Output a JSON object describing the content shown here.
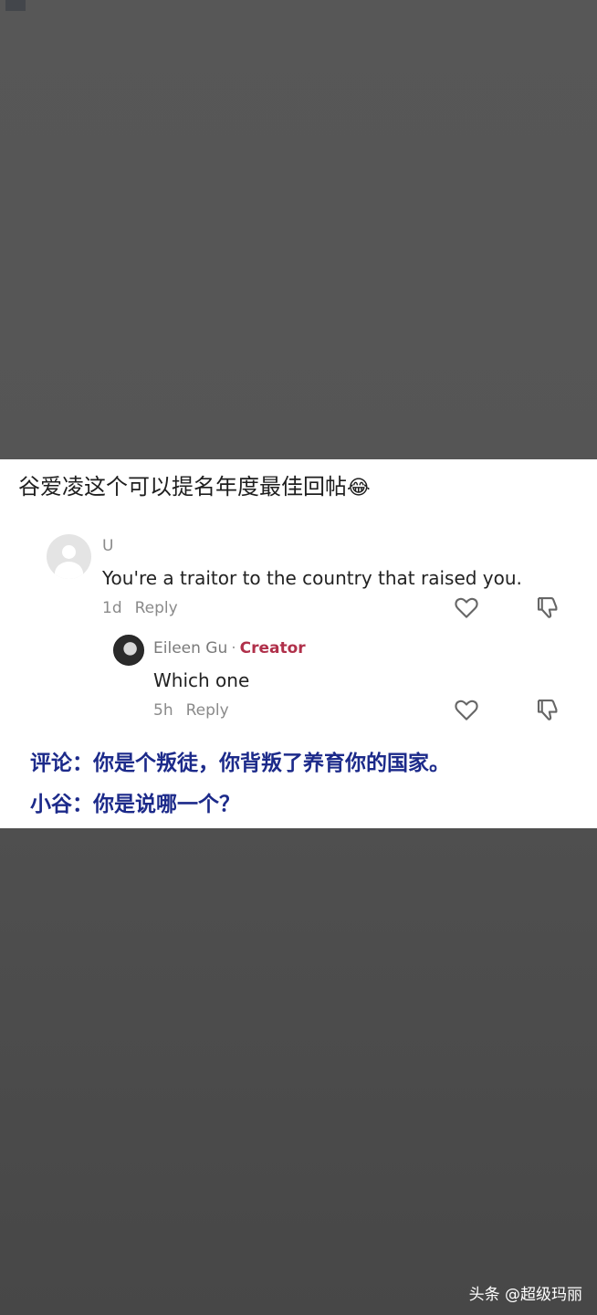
{
  "post": {
    "headline": "谷爱凌这个可以提名年度最佳回帖",
    "headline_emoji": "😂"
  },
  "comment": {
    "username": "U",
    "text": "You're a traitor to the country that raised you.",
    "age": "1d",
    "reply_label": "Reply"
  },
  "reply": {
    "username": "Eileen Gu",
    "separator": "·",
    "badge": "Creator",
    "text": "Which one",
    "age": "5h",
    "reply_label": "Reply"
  },
  "captions": {
    "line1": "评论：你是个叛徒，你背叛了养育你的国家。",
    "line2": "小谷：你是说哪一个？"
  },
  "watermark": "头条 @超级玛丽",
  "colors": {
    "caption": "#1c2a8a",
    "creator_badge": "#b0304a",
    "background": "#4d4d4d"
  },
  "icons": [
    "heart-icon",
    "thumbs-down-icon",
    "default-avatar-icon"
  ]
}
